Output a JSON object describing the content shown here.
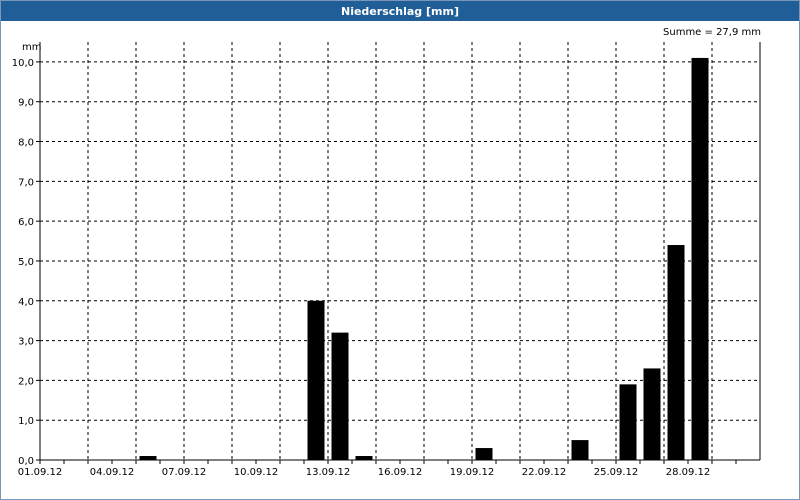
{
  "window": {
    "title": "Niederschlag [mm]"
  },
  "summary": {
    "text": "Summe = 27,9 mm"
  },
  "chart_data": {
    "type": "bar",
    "title": "Niederschlag [mm]",
    "ylabel": "mm",
    "ylim": [
      0,
      10.5
    ],
    "yticks": [
      "0,0",
      "1,0",
      "2,0",
      "3,0",
      "4,0",
      "5,0",
      "6,0",
      "7,0",
      "8,0",
      "9,0",
      "10,0"
    ],
    "x_range_days": [
      1,
      30
    ],
    "xtick_days": [
      1,
      4,
      7,
      10,
      13,
      16,
      19,
      22,
      25,
      28
    ],
    "xticks": [
      "01.09.12",
      "04.09.12",
      "07.09.12",
      "10.09.12",
      "13.09.12",
      "16.09.12",
      "19.09.12",
      "22.09.12",
      "25.09.12",
      "28.09.12"
    ],
    "categories": [
      "05.09.12",
      "12.09.12",
      "13.09.12",
      "14.09.12",
      "19.09.12",
      "23.09.12",
      "25.09.12",
      "26.09.12",
      "27.09.12",
      "28.09.12"
    ],
    "days": [
      5,
      12,
      13,
      14,
      19,
      23,
      25,
      26,
      27,
      28
    ],
    "values": [
      0.1,
      4.0,
      3.2,
      0.1,
      0.3,
      0.5,
      1.9,
      2.3,
      5.4,
      10.1
    ],
    "grid": true,
    "bar_color": "#000000"
  }
}
